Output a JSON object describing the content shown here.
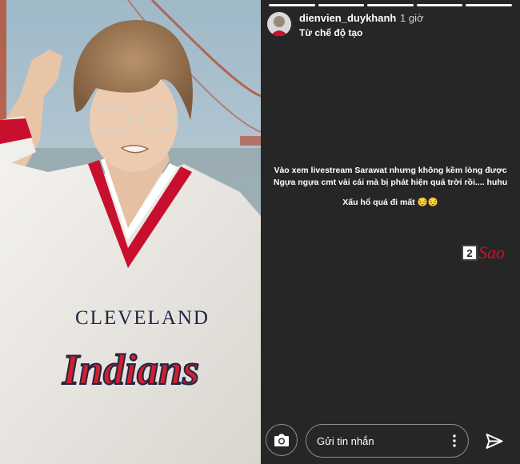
{
  "story": {
    "username": "dienvien_duykhanh",
    "time_ago": "1 giờ",
    "subtitle": "Từ chế độ tạo",
    "progress_total": 5,
    "progress_current": 5,
    "caption_lines": [
      "Vào xem livestream Sarawat nhưng không kềm lòng được",
      "Ngựa ngựa cmt vài cái mà bị phát hiện quá trời rồi.... huhu",
      "Xấu hổ quá đi mất 😔😔"
    ],
    "reply_placeholder": "Gửi tin nhắn"
  },
  "photo": {
    "shirt_text": "CLEVELAND",
    "logo_text": "Indians"
  },
  "watermark": {
    "number": "2",
    "text": "Sao"
  },
  "colors": {
    "story_bg": "#262626",
    "accent_red": "#c8102e"
  },
  "icons": [
    "camera-icon",
    "more-vertical-icon",
    "send-icon"
  ]
}
